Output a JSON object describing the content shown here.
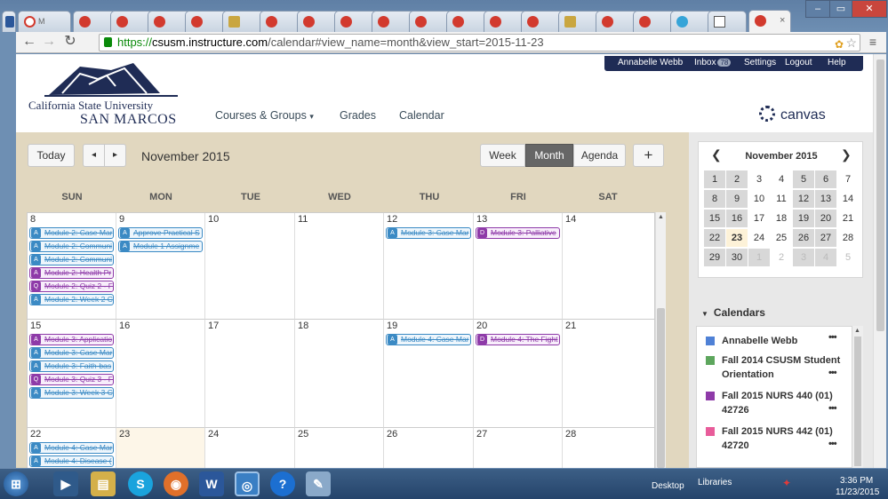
{
  "browser": {
    "tabs": [
      "M",
      "",
      "",
      "",
      "",
      "",
      "",
      "",
      "",
      "",
      "",
      "",
      "",
      "",
      "",
      "",
      "",
      "",
      "",
      "",
      "",
      "",
      "",
      "",
      "",
      "",
      "",
      "",
      "",
      "",
      "",
      "",
      "",
      "",
      ""
    ],
    "url_https": "https://",
    "url_host": "csusm.instructure.com",
    "url_path": "/calendar#view_name=month&view_start=2015-11-23"
  },
  "header": {
    "logo_line1": "California State University",
    "logo_line2": "SAN MARCOS",
    "nav": [
      "Courses & Groups",
      "Grades",
      "Calendar"
    ],
    "nav_caret": "▾",
    "user": "Annabelle Webb",
    "inbox": "Inbox",
    "inbox_count": "78",
    "settings": "Settings",
    "logout": "Logout",
    "help": "Help",
    "canvas_logo": "canvas"
  },
  "toolbar": {
    "today": "Today",
    "prev": "◂",
    "next": "▸",
    "title": "November 2015",
    "week": "Week",
    "month": "Month",
    "agenda": "Agenda",
    "add": "+"
  },
  "weekdays": [
    "SUN",
    "MON",
    "TUE",
    "WED",
    "THU",
    "FRI",
    "SAT"
  ],
  "weeks": [
    {
      "days": [
        "8",
        "9",
        "10",
        "11",
        "12",
        "13",
        "14"
      ]
    },
    {
      "days": [
        "15",
        "16",
        "17",
        "18",
        "19",
        "20",
        "21"
      ]
    },
    {
      "days": [
        "22",
        "23",
        "24",
        "25",
        "26",
        "27",
        "28"
      ]
    }
  ],
  "events": {
    "w0d0": [
      {
        "t": "Module 2: Case Mar",
        "c": "blue",
        "i": "A"
      },
      {
        "t": "Module 2: Communi",
        "c": "blue",
        "i": "A"
      },
      {
        "t": "Module 2: Communi",
        "c": "blue",
        "i": "A"
      },
      {
        "t": "Module 2: Health Pr",
        "c": "purple",
        "i": "A"
      },
      {
        "t": "Module 2: Quiz 2 - F",
        "c": "purple",
        "i": "Q"
      },
      {
        "t": "Module 2: Week 2 C",
        "c": "blue",
        "i": "A"
      }
    ],
    "w0d1": [
      {
        "t": "Approve Practical S",
        "c": "blue",
        "i": "A"
      },
      {
        "t": "Module 1 Assignme",
        "c": "blue",
        "i": "A"
      }
    ],
    "w0d4": [
      {
        "t": "Module 3: Case Mar",
        "c": "blue",
        "i": "A"
      }
    ],
    "w0d5": [
      {
        "t": "Module 3: Palliative",
        "c": "purple",
        "i": "D"
      }
    ],
    "w1d0": [
      {
        "t": "Module 3: Applicatio",
        "c": "purple",
        "i": "A"
      },
      {
        "t": "Module 3: Case Mar",
        "c": "blue",
        "i": "A"
      },
      {
        "t": "Module 3: Faith-bas",
        "c": "blue",
        "i": "A"
      },
      {
        "t": "Module 3: Quiz 3 - F",
        "c": "purple",
        "i": "Q"
      },
      {
        "t": "Module 3: Week 3 C",
        "c": "blue",
        "i": "A"
      }
    ],
    "w1d4": [
      {
        "t": "Module 4: Case Mar",
        "c": "blue",
        "i": "A"
      }
    ],
    "w1d5": [
      {
        "t": "Module 4: The Fight",
        "c": "purple",
        "i": "D"
      }
    ],
    "w2d0": [
      {
        "t": "Module 4: Case Mar",
        "c": "blue",
        "i": "A"
      },
      {
        "t": "Module 4: Disease (",
        "c": "blue",
        "i": "A"
      }
    ]
  },
  "minical": {
    "title": "November 2015",
    "prev": "❮",
    "next": "❯",
    "rows": [
      [
        "1",
        "2",
        "3",
        "4",
        "5",
        "6",
        "7"
      ],
      [
        "8",
        "9",
        "10",
        "11",
        "12",
        "13",
        "14"
      ],
      [
        "15",
        "16",
        "17",
        "18",
        "19",
        "20",
        "21"
      ],
      [
        "22",
        "23",
        "24",
        "25",
        "26",
        "27",
        "28"
      ],
      [
        "29",
        "30",
        "1",
        "2",
        "3",
        "4",
        "5"
      ]
    ]
  },
  "calendars": {
    "heading": "Calendars",
    "items": [
      {
        "name": "Annabelle Webb",
        "color": "#4f81d6"
      },
      {
        "name": "Fall 2014 CSUSM Student Orientation",
        "color": "#5da65d"
      },
      {
        "name": "Fall 2015 NURS 440 (01) 42726",
        "color": "#8e3aa8"
      },
      {
        "name": "Fall 2015 NURS 442 (01) 42720",
        "color": "#e85c9a"
      }
    ],
    "dots": "•••"
  },
  "taskbar": {
    "desktop": "Desktop",
    "libraries": "Libraries",
    "time": "3:36 PM",
    "date": "11/23/2015"
  }
}
